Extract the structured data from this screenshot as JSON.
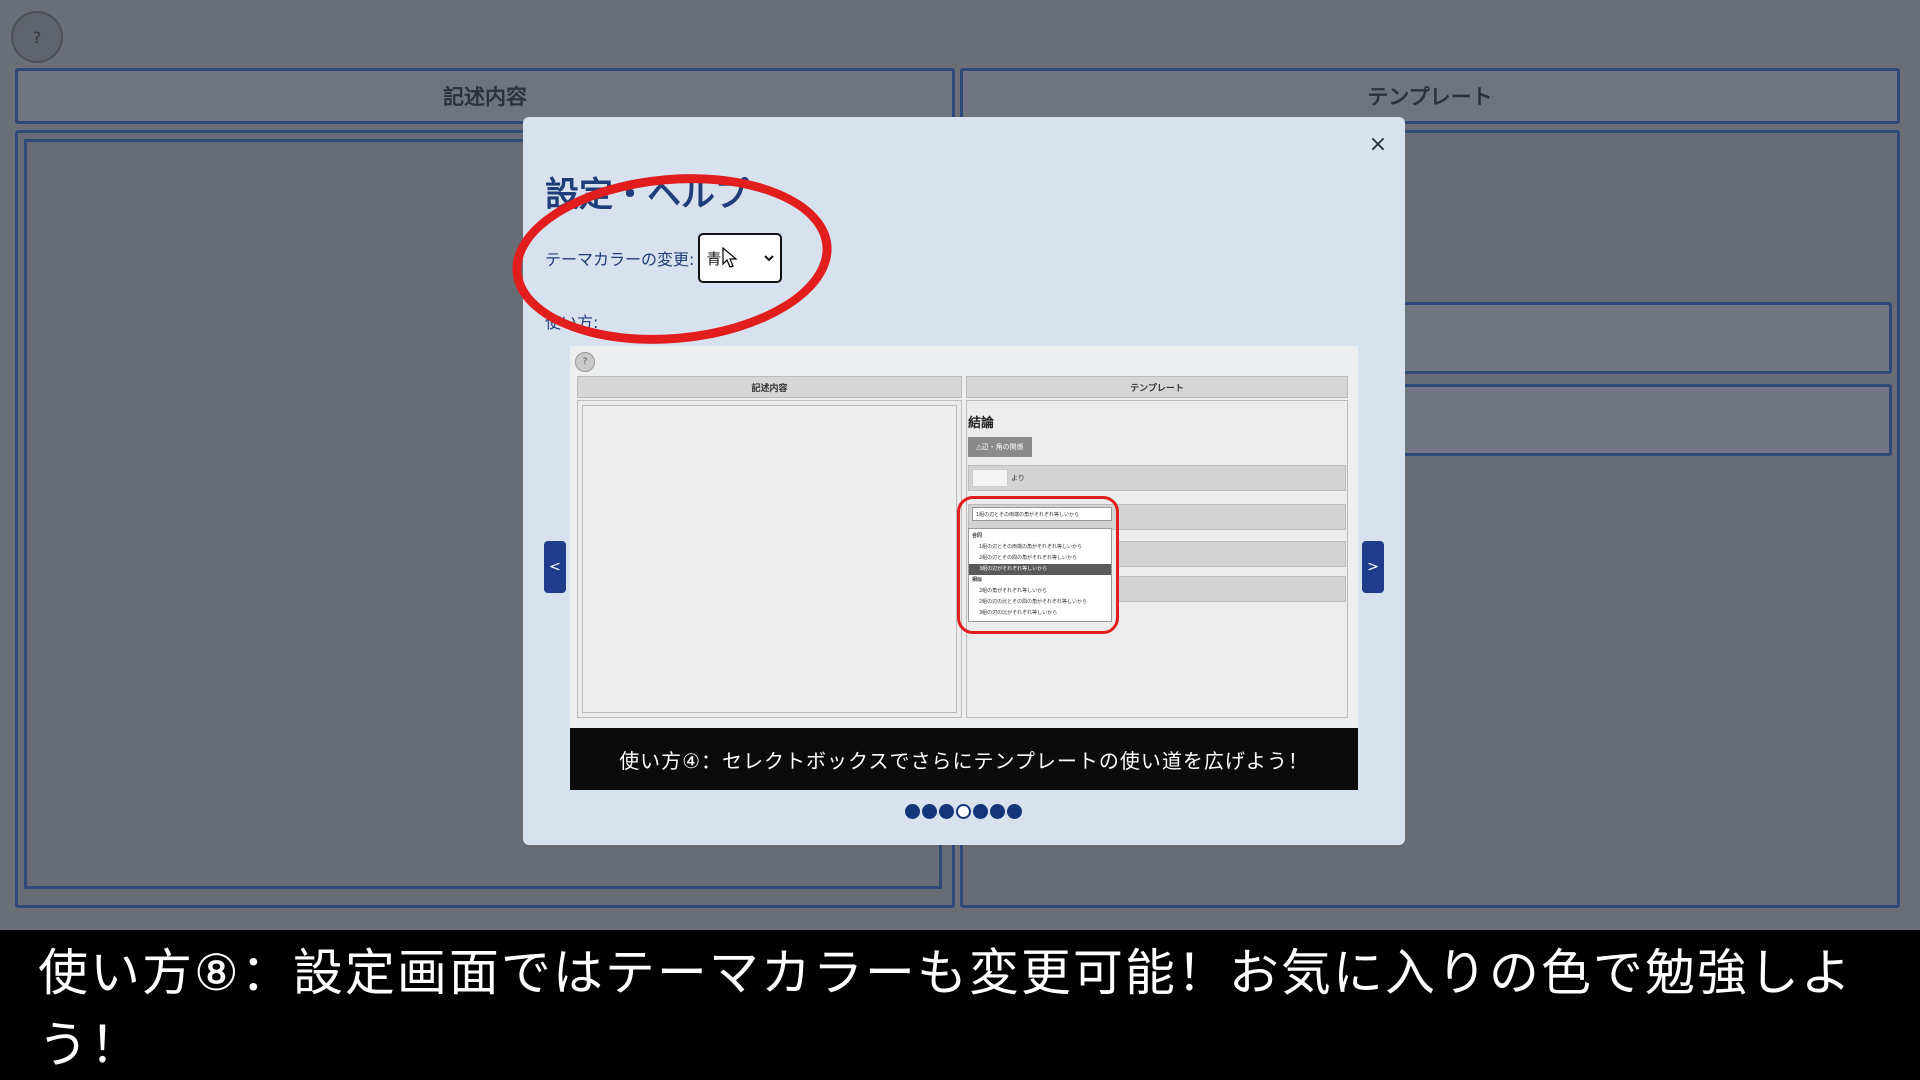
{
  "app": {
    "help_icon": "?",
    "left_tab": "記述内容",
    "right_tab": "テンプレート"
  },
  "modal": {
    "close_icon": "×",
    "title": "設定・ヘルプ",
    "theme_label": "テーマカラーの変更:",
    "theme_value": "青",
    "usage_label": "使い方:",
    "prev_label": "<",
    "next_label": ">",
    "slide_caption": "使い方④：セレクトボックスでさらにテンプレートの使い道を広げよう！",
    "dots_total": 7,
    "dots_active_index": 3
  },
  "slide_screenshot": {
    "help_icon": "?",
    "left_tab": "記述内容",
    "right_tab": "テンプレート",
    "heading": "結論",
    "button": "△辺・角の関係",
    "yori": "より",
    "select_value": "1組の辺とその両端の角がそれぞれ等しいから",
    "options": [
      {
        "type": "group",
        "text": "合同"
      },
      {
        "type": "item",
        "text": "1組の辺とその両端の角がそれぞれ等しいから"
      },
      {
        "type": "item",
        "text": "2組の辺とその間の角がそれぞれ等しいから"
      },
      {
        "type": "item",
        "text": "3組の辺がそれぞれ等しいから",
        "selected": true
      },
      {
        "type": "group",
        "text": "相似"
      },
      {
        "type": "item",
        "text": "2組の角がそれぞれ等しいから"
      },
      {
        "type": "item",
        "text": "2組の辺の比とその間の角がそれぞれ等しいから"
      },
      {
        "type": "item",
        "text": "3組の辺の比がそれぞれ等しいから"
      }
    ]
  },
  "subtitle": "使い方⑧：設定画面ではテーマカラーも変更可能！お気に入りの色で勉強しよう！",
  "colors": {
    "accent": "#1f3d7a",
    "annotation_red": "#e11d1d"
  }
}
